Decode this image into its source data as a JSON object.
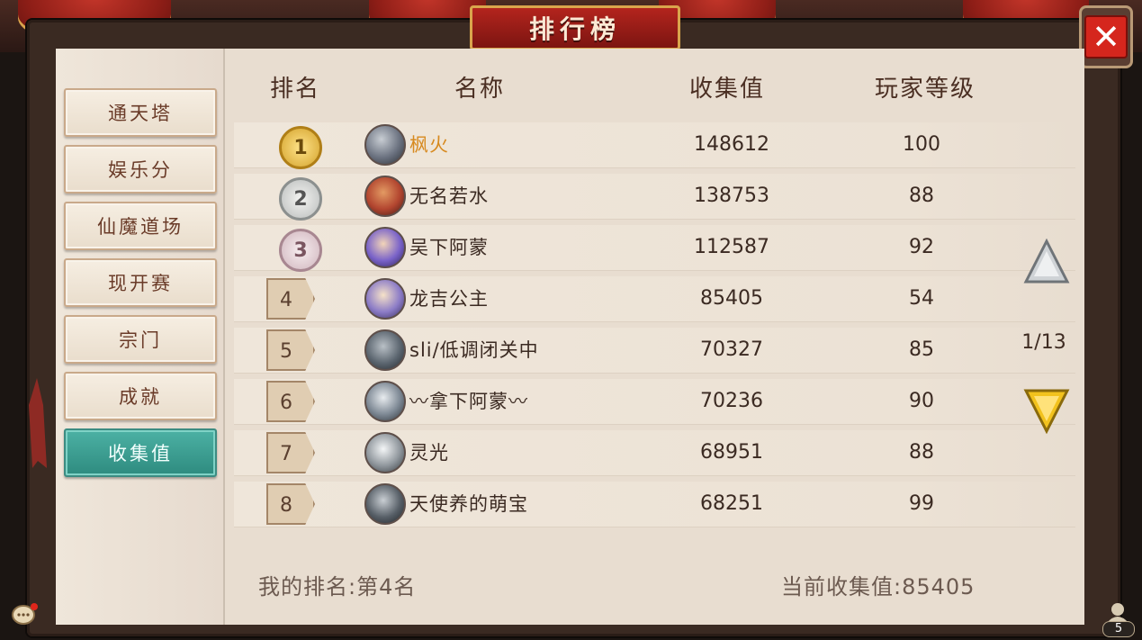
{
  "window": {
    "title": "排行榜",
    "close_symbol": "✕"
  },
  "sidebar": {
    "items": [
      {
        "label": "通天塔",
        "active": false
      },
      {
        "label": "娱乐分",
        "active": false
      },
      {
        "label": "仙魔道场",
        "active": false
      },
      {
        "label": "现开赛",
        "active": false
      },
      {
        "label": "宗门",
        "active": false
      },
      {
        "label": "成就",
        "active": false
      },
      {
        "label": "收集值",
        "active": true
      }
    ]
  },
  "table": {
    "headers": {
      "rank": "排名",
      "name": "名称",
      "value": "收集值",
      "level": "玩家等级"
    },
    "rows": [
      {
        "rank": "1",
        "name": "枫火",
        "value": "148612",
        "level": "100",
        "medal": "gold",
        "avatar_color": "#6b7280"
      },
      {
        "rank": "2",
        "name": "无名若水",
        "value": "138753",
        "level": "88",
        "medal": "silver",
        "avatar_color": "#b2452f"
      },
      {
        "rank": "3",
        "name": "吴下阿蒙",
        "value": "112587",
        "level": "92",
        "medal": "bronze",
        "avatar_color": "#7a63c9"
      },
      {
        "rank": "4",
        "name": "龙吉公主",
        "value": "85405",
        "level": "54",
        "medal": "flag",
        "avatar_color": "#8c7cc7"
      },
      {
        "rank": "5",
        "name": "sli/低调闭关中",
        "value": "70327",
        "level": "85",
        "medal": "flag",
        "avatar_color": "#5c6670"
      },
      {
        "rank": "6",
        "name": "〰拿下阿蒙〰",
        "value": "70236",
        "level": "90",
        "medal": "flag",
        "avatar_color": "#7d8894"
      },
      {
        "rank": "7",
        "name": "灵光",
        "value": "68951",
        "level": "88",
        "medal": "flag",
        "avatar_color": "#8f969c"
      },
      {
        "rank": "8",
        "name": "天使养的萌宝",
        "value": "68251",
        "level": "99",
        "medal": "flag",
        "avatar_color": "#586068"
      }
    ]
  },
  "footer": {
    "my_rank": "我的排名:第4名",
    "current_value": "当前收集值:85405"
  },
  "pagination": {
    "page": "1/13"
  },
  "badges": {
    "friends_count": "5"
  }
}
